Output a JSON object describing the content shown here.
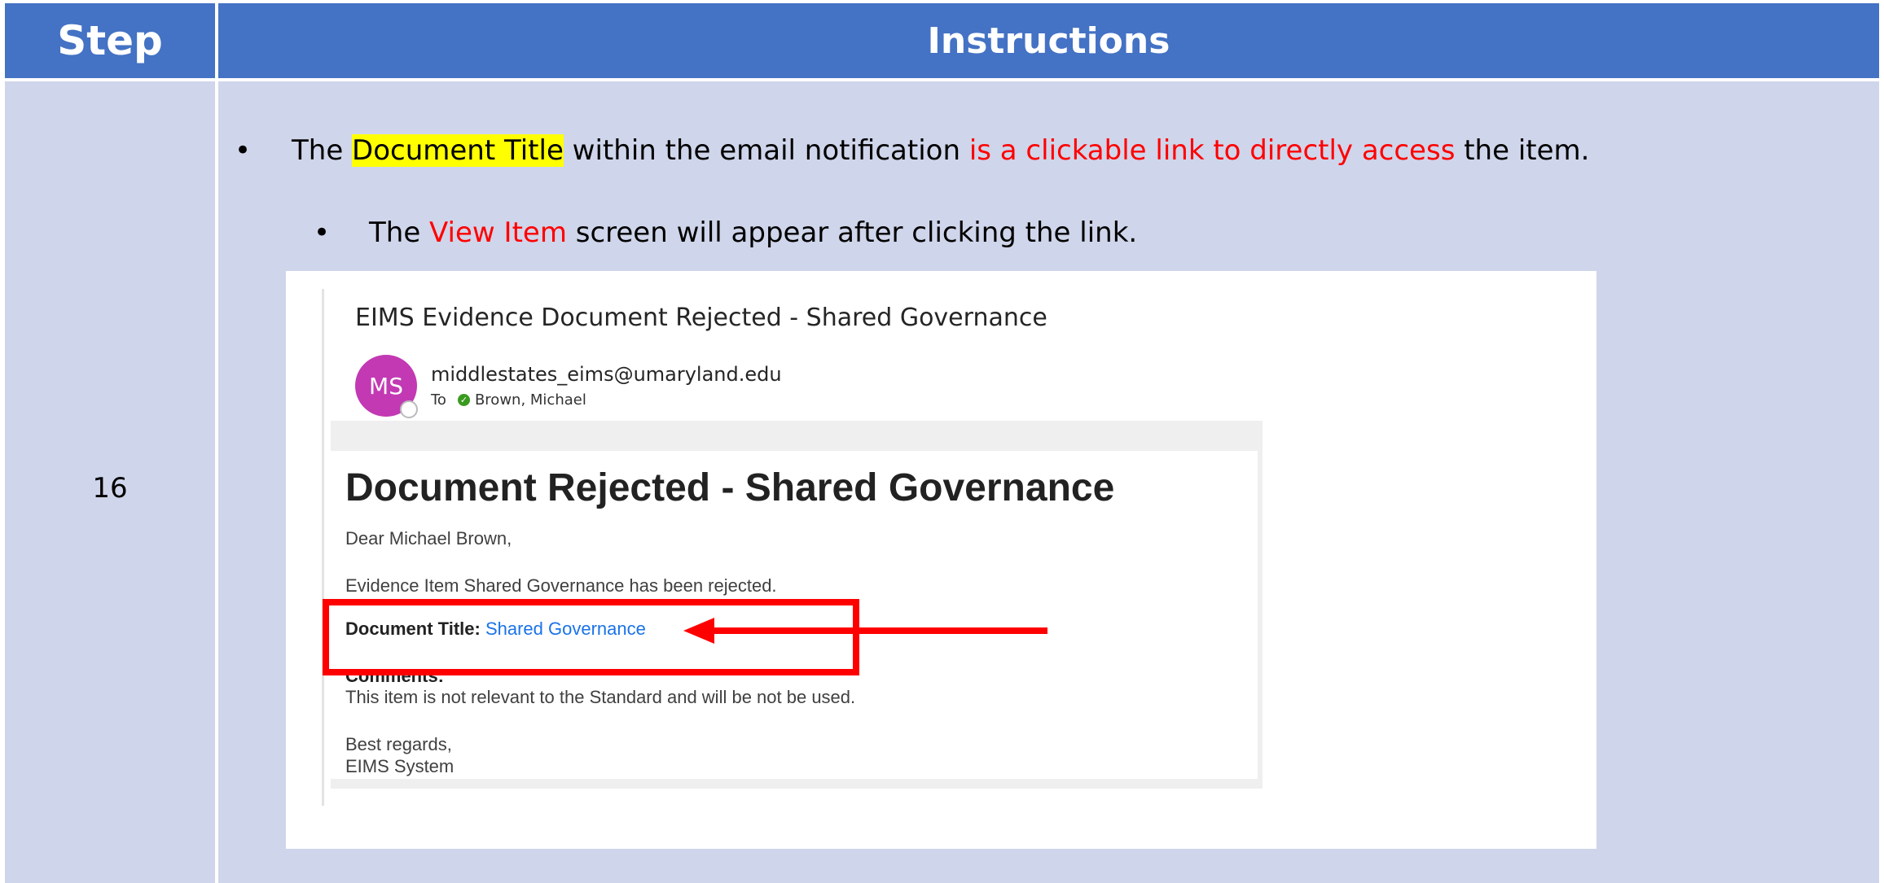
{
  "header": {
    "step": "Step",
    "instructions": "Instructions"
  },
  "row": {
    "step_number": "16",
    "bullet1": {
      "pre": "The ",
      "highlight": "Document Title",
      "mid": " within the email notification ",
      "red": "is a clickable link to directly access",
      "post": " the item."
    },
    "bullet2": {
      "pre": "The ",
      "red": "View Item",
      "post": " screen will appear after clicking the link."
    }
  },
  "email": {
    "subject": "EIMS Evidence Document Rejected - Shared  Governance",
    "avatar_initials": "MS",
    "sender": "middlestates_eims@umaryland.edu",
    "to_label": "To",
    "recipient": "Brown, Michael",
    "heading": "Document Rejected - Shared Governance",
    "greeting": "Dear Michael Brown,",
    "status_line": "Evidence Item Shared Governance has been rejected.",
    "doc_title_label": "Document Title:",
    "doc_title_link": "Shared Governance",
    "comments_label": "Comments:",
    "comments_text": "This item is not relevant to the Standard and will be not be used.",
    "signoff": "Best regards,",
    "signature": "EIMS System"
  },
  "colors": {
    "header_bg": "#4472C4",
    "row_bg": "#CFD5EA",
    "emphasis": "#FF0000",
    "highlight": "#FFFF00",
    "avatar": "#C239B3",
    "link": "#1A73E8"
  },
  "icons": [
    "recipient-check-icon",
    "red-arrow-icon",
    "presence-status-icon"
  ]
}
